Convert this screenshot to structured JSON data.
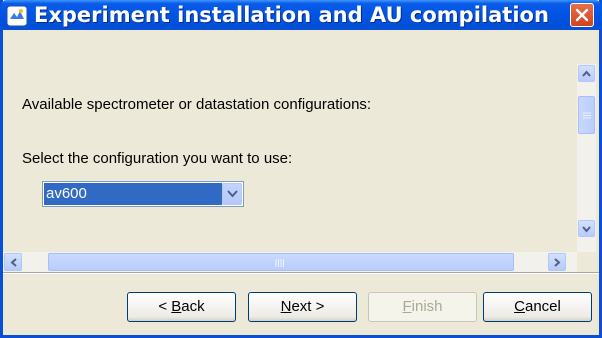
{
  "window": {
    "title": "Experiment installation and AU compilation"
  },
  "content": {
    "label_available": "Available spectrometer or datastation configurations:",
    "label_select": "Select the configuration you want to use:",
    "configuration": {
      "selected": "av600"
    }
  },
  "buttons": {
    "back": {
      "prefix": "< ",
      "mnemonic": "B",
      "rest": "ack"
    },
    "next": {
      "prefix": "",
      "mnemonic": "N",
      "rest": "ext >"
    },
    "finish": {
      "prefix": "",
      "mnemonic": "F",
      "rest": "inish",
      "enabled": false
    },
    "cancel": {
      "prefix": "",
      "mnemonic": "C",
      "rest": "ancel"
    }
  },
  "colors": {
    "titlebar": "#0054e3",
    "selection": "#316ac5",
    "dialog_bg": "#ece9d8"
  },
  "icons": {
    "app": "app-icon",
    "close": "close-icon",
    "scroll_up": "arrow-up-icon",
    "scroll_down": "arrow-down-icon",
    "scroll_left": "arrow-left-icon",
    "scroll_right": "arrow-right-icon",
    "dropdown": "chevron-down-icon"
  }
}
